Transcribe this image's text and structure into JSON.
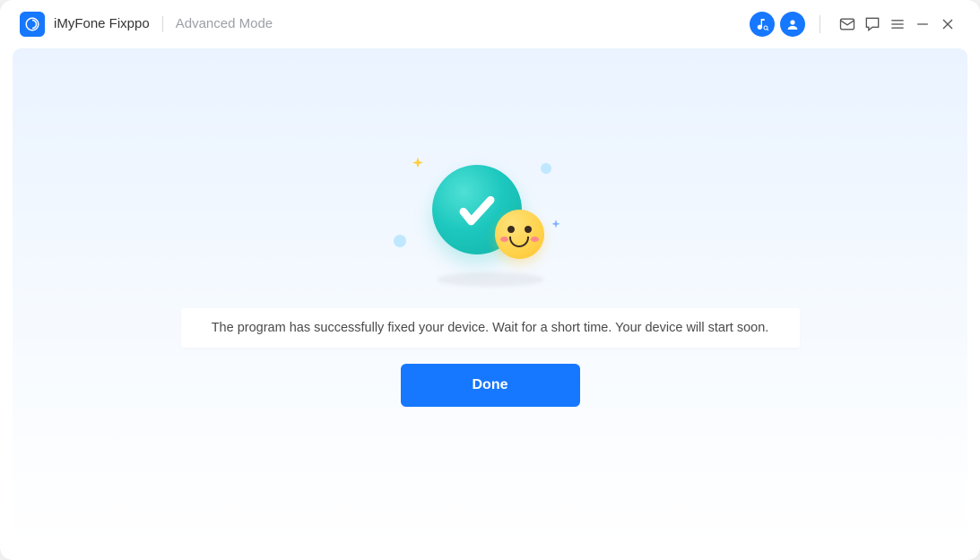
{
  "titlebar": {
    "app_name": "iMyFone Fixppo",
    "mode": "Advanced Mode"
  },
  "main": {
    "message": "The program has successfully fixed your device. Wait for a short time. Your device will start soon.",
    "done_label": "Done"
  },
  "colors": {
    "primary": "#1677ff",
    "success": "#1dc8be"
  }
}
